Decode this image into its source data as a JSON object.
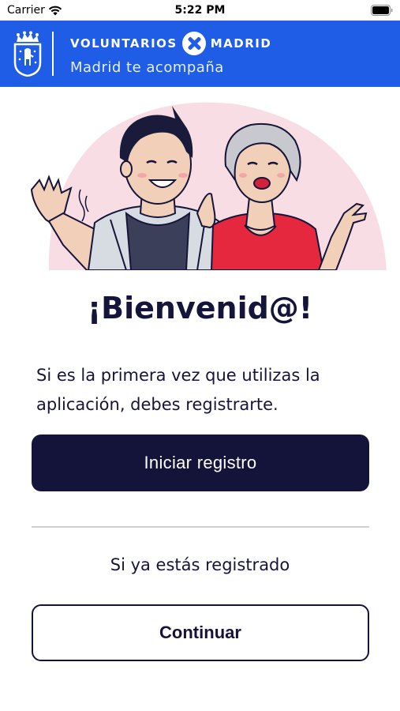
{
  "status_bar": {
    "carrier": "Carrier",
    "time": "5:22 PM",
    "wifi_icon": "wifi-icon",
    "battery_icon": "battery-icon"
  },
  "header": {
    "brand_left": "VOLUNTARIOS",
    "brand_right": "MADRID",
    "tagline": "Madrid te acompaña",
    "logo_icon": "madrid-city-crest",
    "background_color": "#1f5de6"
  },
  "hero": {
    "illustration": "volunteers-waving-illustration"
  },
  "main": {
    "title": "¡Bienvenid@!",
    "intro": "Si es la primera vez que utilizas la aplicación, debes registrarte.",
    "primary_button": "Iniciar registro",
    "registered_prompt": "Si ya estás registrado",
    "secondary_button": "Continuar"
  },
  "colors": {
    "primary": "#14143a",
    "accent": "#1f5de6",
    "hero_blob": "#f7dce3"
  }
}
